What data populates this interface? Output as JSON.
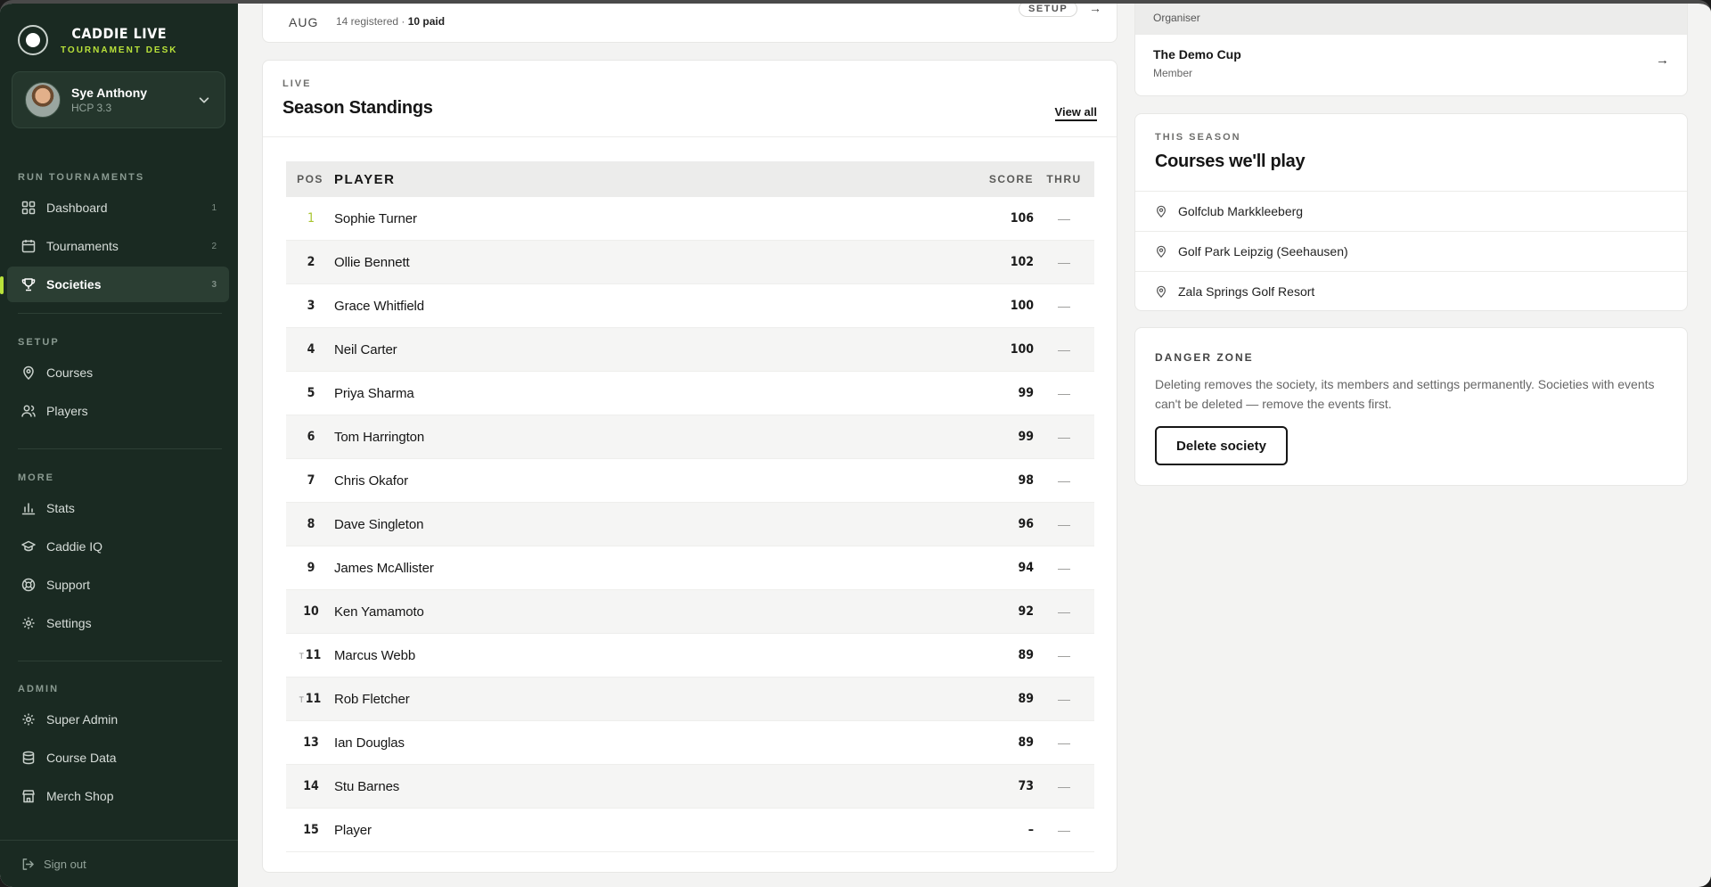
{
  "brand": {
    "title": "CADDIE LIVE",
    "subtitle": "TOURNAMENT DESK"
  },
  "user": {
    "name": "Sye Anthony",
    "hcp": "HCP 3.3"
  },
  "nav": {
    "run_label": "RUN TOURNAMENTS",
    "run_items": [
      {
        "label": "Dashboard",
        "count": "1"
      },
      {
        "label": "Tournaments",
        "count": "2"
      },
      {
        "label": "Societies",
        "count": "3"
      }
    ],
    "setup_label": "SETUP",
    "setup_items": [
      {
        "label": "Courses"
      },
      {
        "label": "Players"
      }
    ],
    "more_label": "MORE",
    "more_items": [
      {
        "label": "Stats"
      },
      {
        "label": "Caddie IQ"
      },
      {
        "label": "Support"
      },
      {
        "label": "Settings"
      }
    ],
    "admin_label": "ADMIN",
    "admin_items": [
      {
        "label": "Super Admin"
      },
      {
        "label": "Course Data"
      },
      {
        "label": "Merch Shop"
      }
    ],
    "sign_out": "Sign out"
  },
  "event": {
    "month": "AUG",
    "registered": "14 registered · ",
    "paid": "10 paid",
    "status": "SETUP",
    "arrow": "→"
  },
  "standings": {
    "eyebrow": "LIVE",
    "title": "Season Standings",
    "view_all": "View all",
    "columns": {
      "pos": "POS",
      "player": "PLAYER",
      "score": "SCORE",
      "thru": "THRU"
    },
    "rows": [
      {
        "tie": "",
        "pos": "1",
        "player": "Sophie Turner",
        "score": "106",
        "thru": "—"
      },
      {
        "tie": "",
        "pos": "2",
        "player": "Ollie Bennett",
        "score": "102",
        "thru": "—"
      },
      {
        "tie": "",
        "pos": "3",
        "player": "Grace Whitfield",
        "score": "100",
        "thru": "—"
      },
      {
        "tie": "",
        "pos": "4",
        "player": "Neil Carter",
        "score": "100",
        "thru": "—"
      },
      {
        "tie": "",
        "pos": "5",
        "player": "Priya Sharma",
        "score": "99",
        "thru": "—"
      },
      {
        "tie": "",
        "pos": "6",
        "player": "Tom Harrington",
        "score": "99",
        "thru": "—"
      },
      {
        "tie": "",
        "pos": "7",
        "player": "Chris Okafor",
        "score": "98",
        "thru": "—"
      },
      {
        "tie": "",
        "pos": "8",
        "player": "Dave Singleton",
        "score": "96",
        "thru": "—"
      },
      {
        "tie": "",
        "pos": "9",
        "player": "James McAllister",
        "score": "94",
        "thru": "—"
      },
      {
        "tie": "",
        "pos": "10",
        "player": "Ken Yamamoto",
        "score": "92",
        "thru": "—"
      },
      {
        "tie": "T",
        "pos": "11",
        "player": "Marcus Webb",
        "score": "89",
        "thru": "—"
      },
      {
        "tie": "T",
        "pos": "11",
        "player": "Rob Fletcher",
        "score": "89",
        "thru": "—"
      },
      {
        "tie": "",
        "pos": "13",
        "player": "Ian Douglas",
        "score": "89",
        "thru": "—"
      },
      {
        "tie": "",
        "pos": "14",
        "player": "Stu Barnes",
        "score": "73",
        "thru": "—"
      },
      {
        "tie": "",
        "pos": "15",
        "player": "Player",
        "score": "–",
        "thru": "—"
      }
    ]
  },
  "memberships": {
    "organiser_role": "Organiser",
    "cup_name": "The Demo Cup",
    "cup_role": "Member",
    "arrow": "→"
  },
  "courses": {
    "eyebrow": "THIS SEASON",
    "title": "Courses we'll play",
    "items": [
      "Golfclub Markkleeberg",
      "Golf Park Leipzig (Seehausen)",
      "Zala Springs Golf Resort"
    ]
  },
  "danger": {
    "eyebrow": "DANGER ZONE",
    "text": "Deleting removes the society, its members and settings permanently. Societies with events can't be deleted — remove the events first.",
    "button": "Delete society"
  },
  "colors": {
    "sidebar_bg": "#1a2a22",
    "accent": "#b9e23a",
    "page_bg": "#f3f3f2"
  }
}
